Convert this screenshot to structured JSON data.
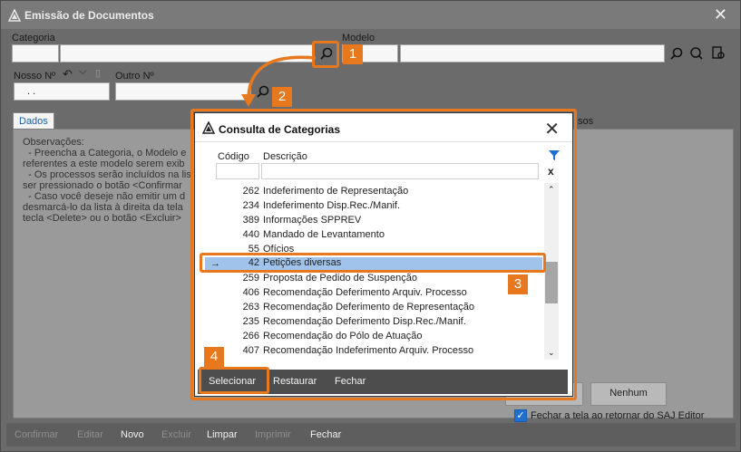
{
  "window": {
    "title": "Emissão de Documentos"
  },
  "form": {
    "categoria_label": "Categoria",
    "modelo_label": "Modelo",
    "nosso_label": "Nosso Nº",
    "nosso_value": ". .",
    "outro_label": "Outro Nº",
    "tab_dados": "Dados",
    "partial_label": "sos",
    "observacoes": [
      "Observações:",
      "  - Preencha a Categoria, o Modelo e",
      "referentes a este modelo serem exib",
      "  - Os processos serão incluídos na lis",
      "ser pressionado o botão <Confirmar",
      "  - Caso você deseje não emitir um d",
      "desmarcá-lo da lista à direita da tela",
      "tecla <Delete> ou o botão <Excluir>"
    ]
  },
  "right_buttons": {
    "nenhum": "Nenhum"
  },
  "checkbox": {
    "label": "Fechar a tela ao retornar do SAJ Editor",
    "checked": true
  },
  "bottom_bar": [
    {
      "label": "Confirmar",
      "enabled": false
    },
    {
      "label": "Editar",
      "enabled": false
    },
    {
      "label": "Novo",
      "enabled": true
    },
    {
      "label": "Excluir",
      "enabled": false
    },
    {
      "label": "Limpar",
      "enabled": true
    },
    {
      "label": "Imprimir",
      "enabled": false
    },
    {
      "label": "Fechar",
      "enabled": true
    }
  ],
  "dialog": {
    "title": "Consulta de Categorias",
    "col_codigo": "Código",
    "col_descricao": "Descrição",
    "clear_filter": "x",
    "rows": [
      {
        "codigo": "262",
        "descricao": "Indeferimento de Representação"
      },
      {
        "codigo": "234",
        "descricao": "Indeferimento Disp.Rec./Manif."
      },
      {
        "codigo": "389",
        "descricao": "Informações SPPREV"
      },
      {
        "codigo": "440",
        "descricao": "Mandado de Levantamento"
      },
      {
        "codigo": "55",
        "descricao": "Ofícios"
      },
      {
        "codigo": "42",
        "descricao": "Petições diversas",
        "selected": true
      },
      {
        "codigo": "259",
        "descricao": "Proposta de Pedido de Suspenção"
      },
      {
        "codigo": "406",
        "descricao": "Recomendação Deferimento Arquiv. Processo"
      },
      {
        "codigo": "263",
        "descricao": "Recomendação Deferimento de Representação"
      },
      {
        "codigo": "235",
        "descricao": "Recomendação Deferimento Disp.Rec./Manif."
      },
      {
        "codigo": "266",
        "descricao": "Recomendação do Pólo de Atuação"
      },
      {
        "codigo": "407",
        "descricao": "Recomendação Indeferimento Arquiv. Processo"
      }
    ],
    "buttons": {
      "selecionar": "Selecionar",
      "restaurar": "Restaurar",
      "fechar": "Fechar"
    }
  },
  "callouts": [
    "1",
    "2",
    "3",
    "4"
  ],
  "colors": {
    "accent": "#e8781e",
    "selection": "#9fc3ea",
    "checkbox": "#1f6fd1"
  }
}
